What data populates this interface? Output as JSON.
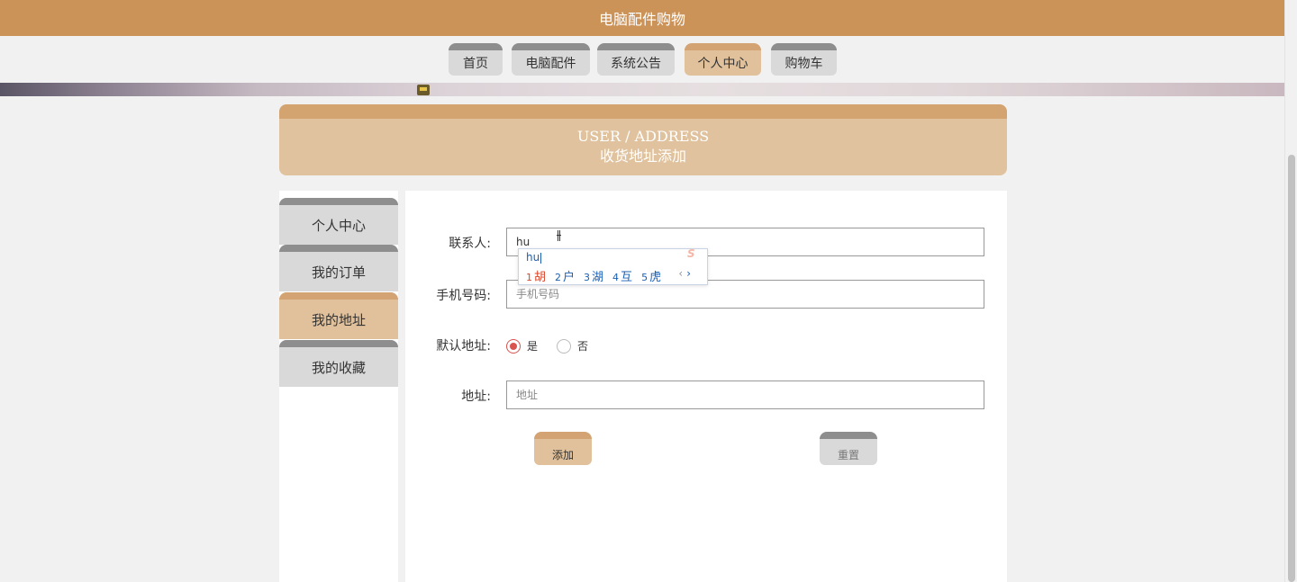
{
  "site": {
    "title": "电脑配件购物"
  },
  "nav": {
    "tabs": [
      {
        "label": "首页"
      },
      {
        "label": "电脑配件"
      },
      {
        "label": "系统公告"
      },
      {
        "label": "个人中心",
        "active": true
      },
      {
        "label": "购物车"
      }
    ]
  },
  "header": {
    "title_en": "USER / ADDRESS",
    "title_cn": "收货地址添加"
  },
  "sidebar": {
    "items": [
      {
        "label": "个人中心"
      },
      {
        "label": "我的订单"
      },
      {
        "label": "我的地址",
        "active": true
      },
      {
        "label": "我的收藏"
      }
    ]
  },
  "form": {
    "contact": {
      "label": "联系人:",
      "value": "hu",
      "placeholder": ""
    },
    "phone": {
      "label": "手机号码:",
      "value": "",
      "placeholder": "手机号码"
    },
    "default_address": {
      "label": "默认地址:",
      "options": [
        {
          "label": "是",
          "checked": true
        },
        {
          "label": "否",
          "checked": false
        }
      ]
    },
    "address": {
      "label": "地址:",
      "value": "",
      "placeholder": "地址"
    },
    "add_label": "添加",
    "reset_label": "重置"
  },
  "ime": {
    "composition": "hu",
    "candidates": [
      {
        "num": "1",
        "char": "胡"
      },
      {
        "num": "2",
        "char": "户"
      },
      {
        "num": "3",
        "char": "湖"
      },
      {
        "num": "4",
        "char": "互"
      },
      {
        "num": "5",
        "char": "虎"
      }
    ],
    "prev": "‹",
    "next": "›",
    "logo": "S"
  },
  "colors": {
    "brand": "#cc9358",
    "accent": "#e0c19b",
    "accent_dark": "#d4a373",
    "neutral": "#d9d9d9",
    "radio_checked": "#d9534f"
  }
}
